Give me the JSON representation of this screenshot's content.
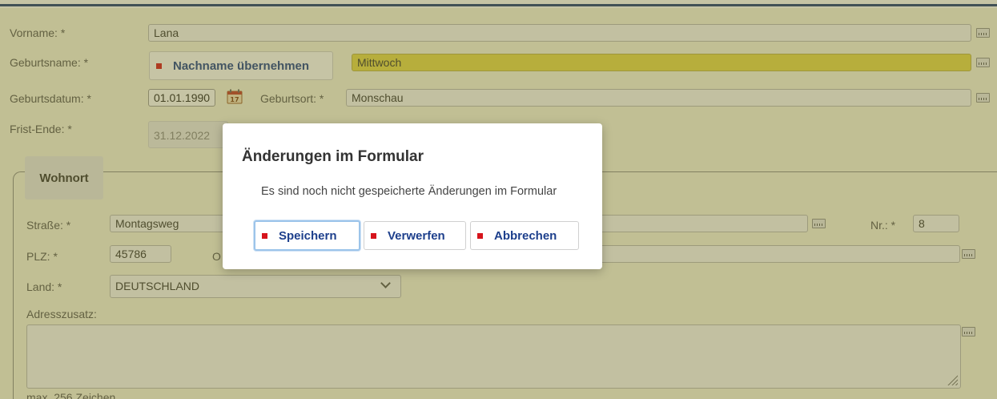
{
  "form": {
    "vorname": {
      "label": "Vorname: *",
      "value": "Lana"
    },
    "geburtsname": {
      "label": "Geburtsname: *",
      "button": "Nachname übernehmen",
      "value": "Mittwoch"
    },
    "geburtsdatum": {
      "label": "Geburtsdatum: *",
      "value": "01.01.1990"
    },
    "geburtsort": {
      "label": "Geburtsort: *",
      "value": "Monschau"
    },
    "frist_ende": {
      "label": "Frist-Ende:  *",
      "value": "31.12.2022"
    }
  },
  "wohnort": {
    "legend": "Wohnort",
    "strasse": {
      "label": "Straße: *",
      "value": "Montagsweg"
    },
    "nr": {
      "label": "Nr.: *",
      "value": "8"
    },
    "plz": {
      "label": "PLZ: *",
      "value": "45786"
    },
    "ort_label_partial": "O",
    "land": {
      "label": "Land: *",
      "value": "DEUTSCHLAND"
    },
    "adresszusatz": {
      "label": "Adresszusatz:",
      "hint": "max. 256 Zeichen"
    }
  },
  "dialog": {
    "title": "Änderungen im Formular",
    "message": "Es sind noch nicht gespeicherte Änderungen im Formular",
    "buttons": {
      "save": "Speichern",
      "discard": "Verwerfen",
      "cancel": "Abbrechen"
    }
  },
  "colors": {
    "accent": "#1d3f8c",
    "button_marker": "#d6141c",
    "highlight_field": "#e6d94a",
    "top_border": "#1d3a78"
  },
  "icons": {
    "keyboard": "keyboard-icon",
    "calendar": "calendar-icon",
    "dropdown": "chevron-down-icon",
    "resize": "resize-grip-icon"
  }
}
